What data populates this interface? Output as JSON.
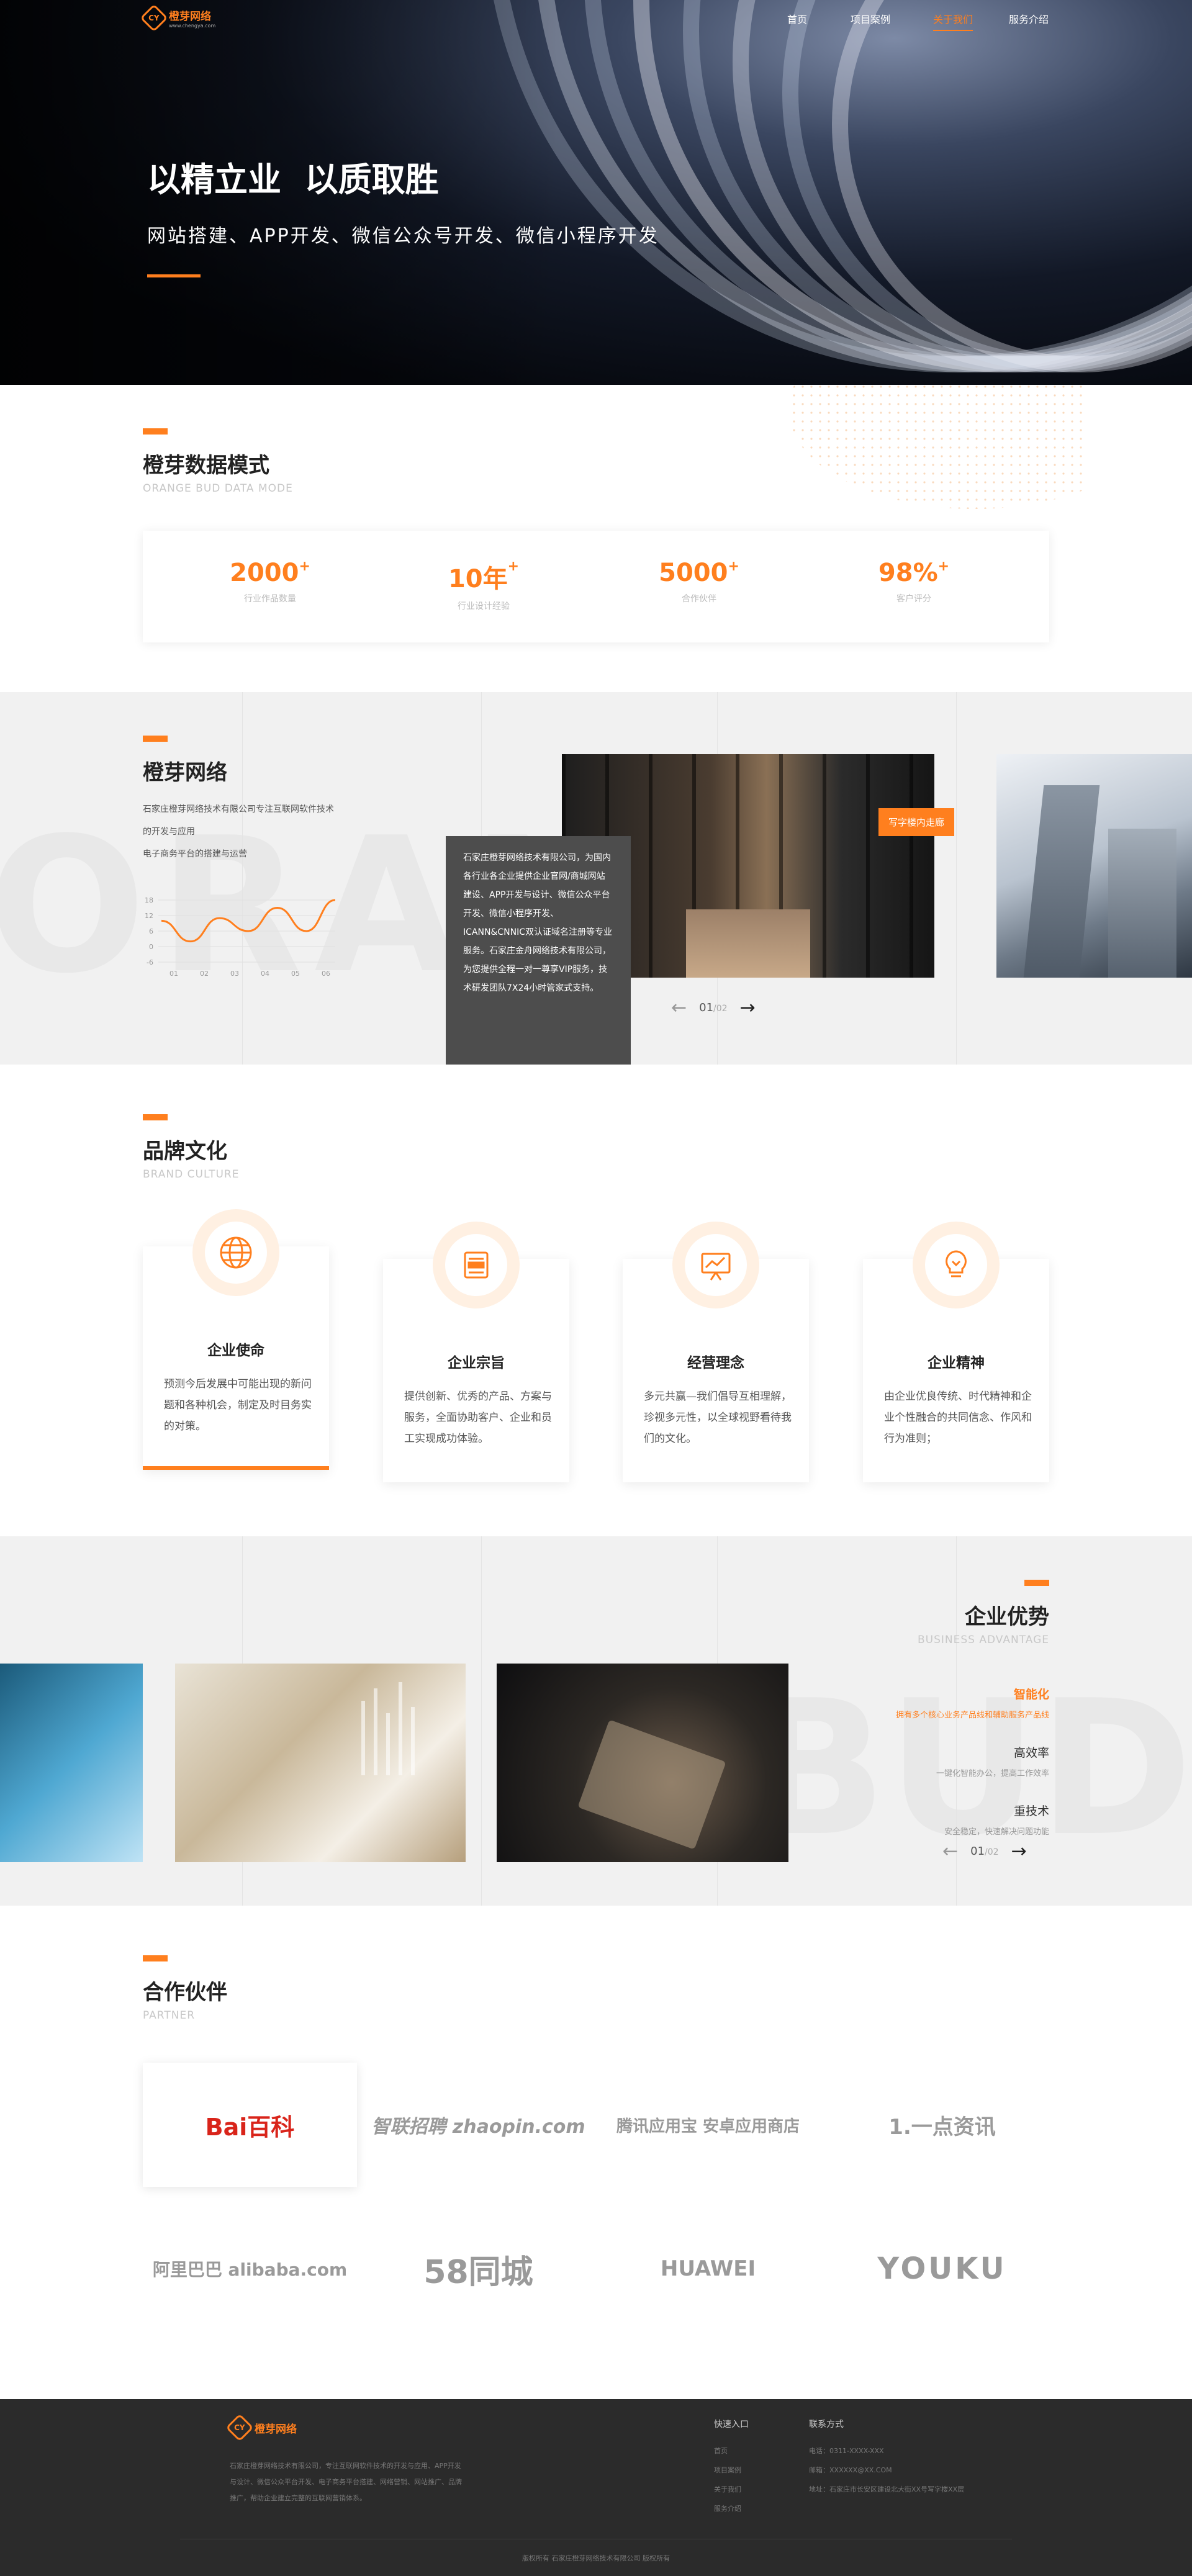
{
  "brand": {
    "name_cn": "橙芽网络",
    "url": "www.chengya.com",
    "accent": "#ff7f1e"
  },
  "nav": {
    "items": [
      "首页",
      "项目案例",
      "关于我们",
      "服务介绍"
    ],
    "active": 2
  },
  "hero": {
    "title": "以精立业  以质取胜",
    "subtitle": "网站搭建、APP开发、微信公众号开发、微信小程序开发"
  },
  "data_mode": {
    "title": "橙芽数据模式",
    "subtitle": "ORANGE BUD DATA MODE",
    "stats": [
      {
        "value": "2000",
        "plus": "+",
        "label": "行业作品数量"
      },
      {
        "value": "10年",
        "plus": "+",
        "label": "行业设计经验"
      },
      {
        "value": "5000",
        "plus": "+",
        "label": "合作伙伴"
      },
      {
        "value": "98%",
        "plus": "+",
        "label": "客户评分"
      }
    ]
  },
  "about": {
    "title": "橙芽网络",
    "intro": [
      "石家庄橙芽网络技术有限公司专注互联网软件技术",
      "的开发与应用",
      "电子商务平台的搭建与运营"
    ],
    "chart_data": {
      "type": "line",
      "categories": [
        "01",
        "02",
        "03",
        "04",
        "05",
        "06"
      ],
      "yticks": [
        "18",
        "12",
        "6",
        "0",
        "-6"
      ],
      "ylim": [
        -6,
        18
      ],
      "series": [
        {
          "values": [
            10,
            2,
            11,
            6,
            15,
            6,
            18
          ]
        }
      ]
    },
    "popup": "石家庄橙芽网络技术有限公司，为国内各行业各企业提供企业官网/商城网站建设、APP开发与设计、微信公众平台开发、微信小程序开发、ICANN&CNNIC双认证域名注册等专业服务。石家庄金舟网络技术有限公司，为您提供全程一对一尊享VIP服务，技术研发团队7X24小时管家式支持。",
    "tag": "写字楼内走廊",
    "pager": {
      "current": "01",
      "total": "/02"
    }
  },
  "culture": {
    "title": "品牌文化",
    "subtitle": "BRAND CULTURE",
    "cards": [
      {
        "icon": "globe-icon",
        "title": "企业使命",
        "text": "预测今后发展中可能出现的新问题和各种机会，制定及时目务实的对策。"
      },
      {
        "icon": "book-icon",
        "title": "企业宗旨",
        "text": "提供创新、优秀的产品、方案与服务，全面协助客户、企业和员工实现成功体验。"
      },
      {
        "icon": "presentation-icon",
        "title": "经营理念",
        "text": "多元共赢—我们倡导互相理解，珍视多元性，以全球视野看待我们的文化。"
      },
      {
        "icon": "lightbulb-icon",
        "title": "企业精神",
        "text": "由企业优良传统、时代精神和企业个性融合的共同信念、作风和行为准则；"
      }
    ]
  },
  "advantage": {
    "title": "企业优势",
    "subtitle": "BUSINESS ADVANTAGE",
    "items": [
      {
        "title": "智能化",
        "desc": "拥有多个核心业务产品线和辅助服务产品线",
        "active": true
      },
      {
        "title": "高效率",
        "desc": "一键化智能办公，提高工作效率",
        "active": false
      },
      {
        "title": "重技术",
        "desc": "安全稳定，快速解决问题功能",
        "active": false
      }
    ],
    "pager": {
      "current": "01",
      "total": "/02"
    }
  },
  "partners": {
    "title": "合作伙伴",
    "subtitle": "PARTNER",
    "logos": [
      {
        "name": "Bai百科",
        "color": "#d9241a"
      },
      {
        "name": "智联招聘 zhaopin.com",
        "color": "#9a9a9a"
      },
      {
        "name": "腾讯应用宝 安卓应用商店",
        "color": "#9a9a9a"
      },
      {
        "name": "1.一点资讯",
        "color": "#9a9a9a"
      },
      {
        "name": "阿里巴巴 alibaba.com",
        "color": "#9a9a9a"
      },
      {
        "name": "58同城",
        "color": "#9a9a9a"
      },
      {
        "name": "HUAWEI",
        "color": "#9a9a9a"
      },
      {
        "name": "YOUKU",
        "color": "#9a9a9a"
      }
    ]
  },
  "footer": {
    "desc": "石家庄橙芽网络技术有限公司，专注互联网软件技术的开发与应用、APP开发与设计、微信公众平台开发、电子商务平台搭建、网络营销、网站推广、品牌推广，帮助企业建立完整的互联网营销体系。",
    "links_title": "快速入口",
    "links": [
      "首页",
      "项目案例",
      "关于我们",
      "服务介绍"
    ],
    "contact_title": "联系方式",
    "contact": [
      "电话：0311-XXXX-XXX",
      "邮箱：XXXXXX@XX.COM",
      "地址：石家庄市长安区建设北大街XX号写字楼XX层"
    ],
    "copyright": "版权所有 石家庄橙芽网络技术有限公司 版权所有"
  }
}
